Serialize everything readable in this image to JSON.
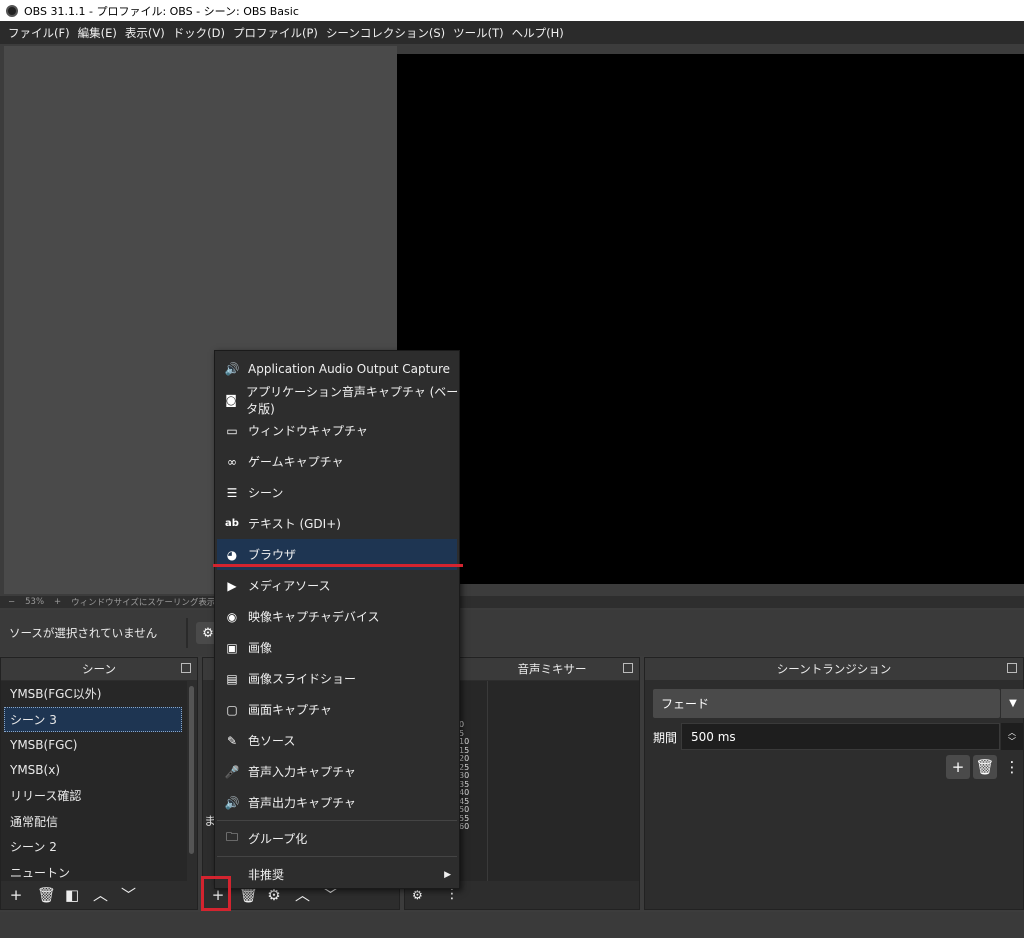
{
  "window": {
    "title": "OBS 31.1.1 - プロファイル: OBS - シーン: OBS Basic"
  },
  "menubar": [
    "ファイル(F)",
    "編集(E)",
    "表示(V)",
    "ドック(D)",
    "プロファイル(P)",
    "シーンコレクション(S)",
    "ツール(T)",
    "ヘルプ(H)"
  ],
  "zoom": {
    "minus": "−",
    "value": "53%",
    "plus": "+",
    "mode": "ウィンドウサイズにスケーリング表示"
  },
  "context_bar": {
    "no_source": "ソースが選択されていません"
  },
  "scenes": {
    "title": "シーン",
    "items": [
      "YMSB(FGC以外)",
      "シーン 3",
      "YMSB(FGC)",
      "YMSB(x)",
      "リリース確認",
      "通常配信",
      "シーン 2",
      "ニュートン"
    ],
    "selected_index": 1
  },
  "sources": {
    "partial_text": "ま"
  },
  "mixer": {
    "title": "音声ミキサー",
    "ticks": [
      "0",
      "5",
      "10",
      "15",
      "20",
      "25",
      "30",
      "35",
      "40",
      "45",
      "50",
      "55",
      "60"
    ]
  },
  "transitions": {
    "title": "シーントランジション",
    "selected": "フェード",
    "duration_label": "期間",
    "duration_value": "500 ms"
  },
  "add_source_menu": {
    "items": [
      {
        "label": "Application Audio Output Capture",
        "icon": "speaker-icon"
      },
      {
        "label": "アプリケーション音声キャプチャ (ベータ版)",
        "icon": "app-audio-icon"
      },
      {
        "label": "ウィンドウキャプチャ",
        "icon": "window-icon"
      },
      {
        "label": "ゲームキャプチャ",
        "icon": "gamepad-icon"
      },
      {
        "label": "シーン",
        "icon": "list-icon"
      },
      {
        "label": "テキスト (GDI+)",
        "icon": "text-icon"
      },
      {
        "label": "ブラウザ",
        "icon": "globe-icon",
        "highlighted": true
      },
      {
        "label": "メディアソース",
        "icon": "play-icon"
      },
      {
        "label": "映像キャプチャデバイス",
        "icon": "camera-icon"
      },
      {
        "label": "画像",
        "icon": "image-icon"
      },
      {
        "label": "画像スライドショー",
        "icon": "slideshow-icon"
      },
      {
        "label": "画面キャプチャ",
        "icon": "monitor-icon"
      },
      {
        "label": "色ソース",
        "icon": "brush-icon"
      },
      {
        "label": "音声入力キャプチャ",
        "icon": "microphone-icon"
      },
      {
        "label": "音声出力キャプチャ",
        "icon": "speaker-icon"
      }
    ],
    "group_label": "グループ化",
    "deprecated_label": "非推奨"
  },
  "colors": {
    "highlight": "#1e3552",
    "annotation_red": "#d3242f",
    "background": "#3c3c3c"
  }
}
